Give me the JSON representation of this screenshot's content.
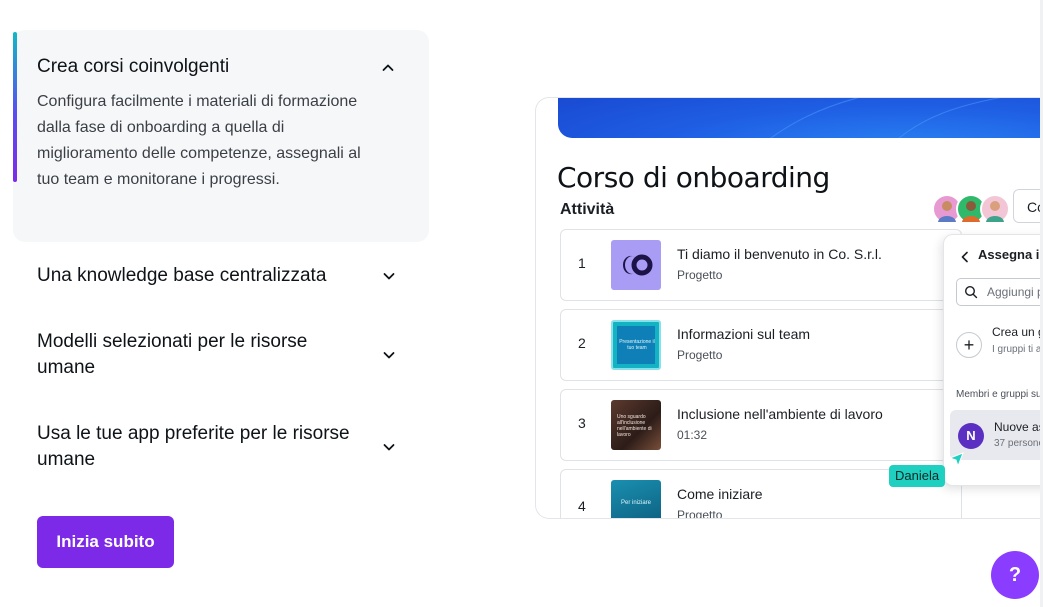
{
  "accordion": {
    "items": [
      {
        "title": "Crea corsi coinvolgenti",
        "expanded": true,
        "description": "Configura facilmente i materiali di formazione dalla fase di onboarding a quella di miglioramento delle competenze, assegnali al tuo team e monitorane i progressi."
      },
      {
        "title": "Una knowledge base centralizzata",
        "expanded": false
      },
      {
        "title": "Modelli selezionati per le risorse umane",
        "expanded": false
      },
      {
        "title": "Usa le tue app preferite per le risorse umane",
        "expanded": false
      }
    ],
    "cta_label": "Inizia subito"
  },
  "preview": {
    "course_title": "Corso di onboarding",
    "activity_label": "Attività",
    "share_label": "Co",
    "activities": [
      {
        "number": "1",
        "title": "Ti diamo il benvenuto in Co. S.r.l.",
        "subtitle": "Progetto"
      },
      {
        "number": "2",
        "title": "Informazioni sul team",
        "subtitle": "Progetto",
        "thumb_text": "Presentazione il tuo team"
      },
      {
        "number": "3",
        "title": "Inclusione nell'ambiente di lavoro",
        "subtitle": "01:32",
        "thumb_text": "Uno sguardo all'inclusione nell'ambiente di lavoro"
      },
      {
        "number": "4",
        "title": "Come iniziare",
        "subtitle": "Progetto",
        "thumb_text": "Per iniziare"
      }
    ],
    "assign_panel": {
      "title": "Assegna il c",
      "search_placeholder": "Aggiungi p",
      "create_group_title": "Crea un g",
      "create_group_sub": "I gruppi ti a persone co",
      "members_label": "Membri e gruppi su",
      "selected_group_initial": "N",
      "selected_group_name": "Nuove as",
      "selected_group_count": "37 persone"
    },
    "cursor_name": "Daniela"
  },
  "help_label": "?",
  "colors": {
    "accent": "#7d2ae8",
    "help": "#8b3dff",
    "cursor": "#1fcfc0",
    "banner": "#1f5fe4"
  }
}
